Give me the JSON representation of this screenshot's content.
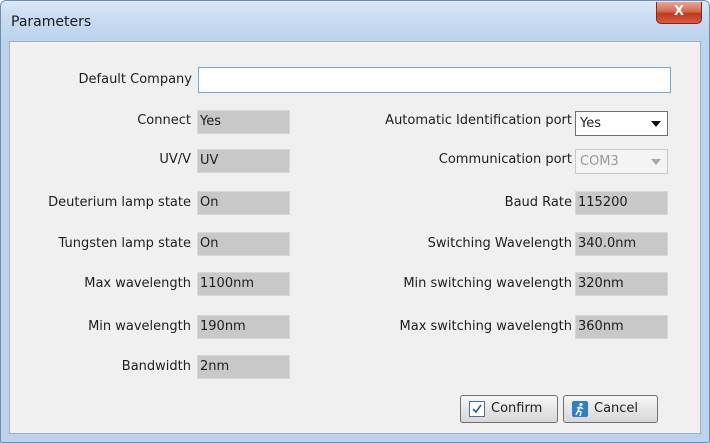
{
  "window": {
    "title": "Parameters",
    "close_glyph": "X"
  },
  "form": {
    "default_company": {
      "label": "Default Company",
      "value": ""
    },
    "left": [
      {
        "label": "Connect",
        "value": "Yes"
      },
      {
        "label": "UV/V",
        "value": "UV"
      },
      {
        "label": "Deuterium lamp state",
        "value": "On"
      },
      {
        "label": "Tungsten lamp state",
        "value": "On"
      },
      {
        "label": "Max wavelength",
        "value": "1100nm"
      },
      {
        "label": "Min wavelength",
        "value": "190nm"
      },
      {
        "label": "Bandwidth",
        "value": "2nm"
      }
    ],
    "right": {
      "auto_id_port": {
        "label": "Automatic Identification port",
        "value": "Yes"
      },
      "comm_port": {
        "label": "Communication port",
        "value": "COM3"
      },
      "baud_rate": {
        "label": "Baud Rate",
        "value": "115200"
      },
      "switching_wavelength": {
        "label": "Switching Wavelength",
        "value": "340.0nm"
      },
      "min_switching_wavelength": {
        "label": "Min switching wavelength",
        "value": "320nm"
      },
      "max_switching_wavelength": {
        "label": "Max switching wavelength",
        "value": "360nm"
      }
    }
  },
  "buttons": {
    "confirm": "Confirm",
    "cancel": "Cancel"
  },
  "icons": {
    "confirm": "checkbox-icon",
    "cancel": "running-man-icon",
    "close": "close-icon"
  }
}
